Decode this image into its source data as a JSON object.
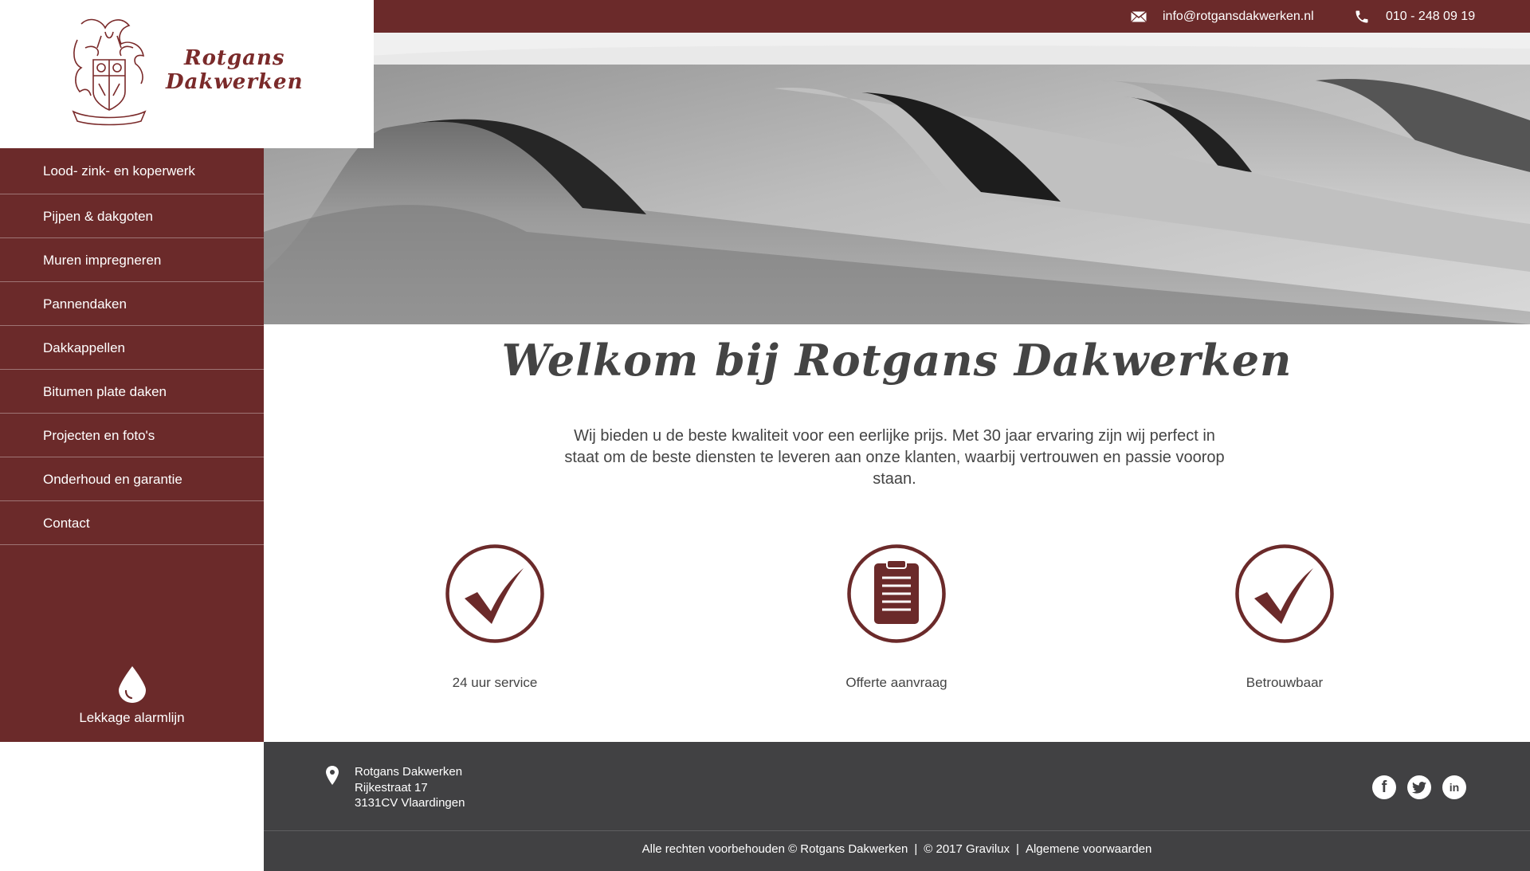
{
  "header": {
    "email": "info@rotgansdakwerken.nl",
    "phone": "010 - 248 09 19",
    "email_icon": "envelope-icon",
    "phone_icon": "phone-icon"
  },
  "logo": {
    "line1": "Rotgans",
    "line2": "Dakwerken"
  },
  "nav": {
    "items": [
      {
        "label": "Lood- zink- en koperwerk"
      },
      {
        "label": "Pijpen & dakgoten"
      },
      {
        "label": "Muren impregneren"
      },
      {
        "label": "Pannendaken"
      },
      {
        "label": "Dakkappellen"
      },
      {
        "label": "Bitumen plate daken"
      },
      {
        "label": "Projecten en foto's"
      },
      {
        "label": "Onderhoud en garantie"
      },
      {
        "label": "Contact"
      }
    ],
    "leak_label": "Lekkage alarmlijn",
    "leak_icon": "water-drop-icon"
  },
  "main": {
    "title": "Welkom bij Rotgans Dakwerken",
    "intro": "Wij bieden u de beste kwaliteit voor een eerlijke prijs. Met 30 jaar ervaring zijn wij perfect in staat om de beste diensten te leveren aan onze klanten, waarbij vertrouwen en passie voorop staan.",
    "features": [
      {
        "label": "24 uur service",
        "icon": "checkmark-icon"
      },
      {
        "label": "Offerte aanvraag",
        "icon": "clipboard-icon"
      },
      {
        "label": "Betrouwbaar",
        "icon": "checkmark-icon"
      }
    ]
  },
  "footer": {
    "company": "Rotgans Dakwerken",
    "street": "Rijkestraat 17",
    "city": "3131CV Vlaardingen",
    "copyright": "Alle rechten voorbehouden © Rotgans Dakwerken",
    "credit": "© 2017 Gravilux",
    "terms": "Algemene voorwaarden",
    "separator": "|",
    "social": {
      "facebook": "f",
      "linkedin": "in"
    }
  },
  "colors": {
    "brand": "#6b2a2a",
    "footer": "#414143",
    "text": "#444444"
  }
}
